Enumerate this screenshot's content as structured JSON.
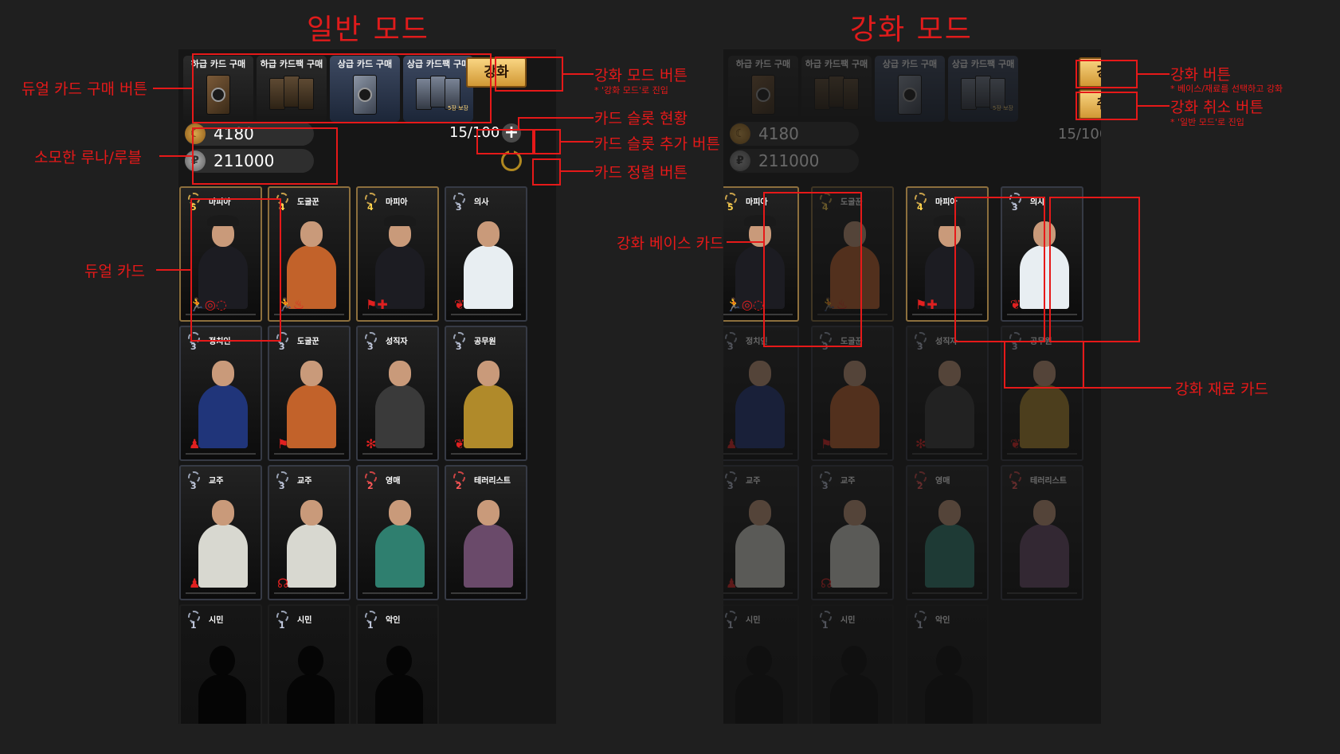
{
  "titles": {
    "normal_mode": "일반 모드",
    "enhance_mode": "강화 모드"
  },
  "store": [
    {
      "label": "하급 카드 구매",
      "tier": "low"
    },
    {
      "label": "하급 카드팩 구매",
      "tier": "low"
    },
    {
      "label": "상급 카드 구매",
      "tier": "high"
    },
    {
      "label": "상급 카드팩 구매",
      "tier": "high",
      "pack_tag": "5장 보장"
    }
  ],
  "buttons": {
    "enhance": "강화",
    "cancel": "취소",
    "plus": "+"
  },
  "currency": {
    "luna": "4180",
    "ruble": "211000",
    "luna_glyph": "☾",
    "ruble_glyph": "₽"
  },
  "slots": "15/100",
  "cards": [
    {
      "name": "마피아",
      "level": "5",
      "badge": "gold",
      "frame": "gold",
      "body": "#1c1c22",
      "icons": "🏃◎◌"
    },
    {
      "name": "도굴꾼",
      "level": "4",
      "badge": "gold",
      "frame": "gold",
      "body": "#c2622a",
      "icons": "🏃♨"
    },
    {
      "name": "마피아",
      "level": "4",
      "badge": "gold",
      "frame": "gold",
      "body": "#1c1c22",
      "icons": "⚑✚"
    },
    {
      "name": "의사",
      "level": "3",
      "badge": "silver",
      "frame": "steel",
      "body": "#e8eef2",
      "icons": "❦"
    },
    {
      "name": "정치인",
      "level": "3",
      "badge": "silver",
      "frame": "steel",
      "body": "#20357a",
      "icons": "♟"
    },
    {
      "name": "도굴꾼",
      "level": "3",
      "badge": "silver",
      "frame": "steel",
      "body": "#c2622a",
      "icons": "⚑"
    },
    {
      "name": "성직자",
      "level": "3",
      "badge": "silver",
      "frame": "steel",
      "body": "#3a3a3a",
      "icons": "✻"
    },
    {
      "name": "공무원",
      "level": "3",
      "badge": "silver",
      "frame": "steel",
      "body": "#b08a2a",
      "icons": "❦"
    },
    {
      "name": "교주",
      "level": "3",
      "badge": "silver",
      "frame": "steel",
      "body": "#d8d8d0",
      "icons": "♟"
    },
    {
      "name": "교주",
      "level": "3",
      "badge": "silver",
      "frame": "steel",
      "body": "#d8d8d0",
      "icons": "☊"
    },
    {
      "name": "영매",
      "level": "2",
      "badge": "red",
      "frame": "steel",
      "body": "#2f7f6f",
      "icons": ""
    },
    {
      "name": "테러리스트",
      "level": "2",
      "badge": "red",
      "frame": "steel",
      "body": "#6a4a6a",
      "icons": ""
    },
    {
      "name": "시민",
      "level": "1",
      "badge": "silver",
      "frame": "blank",
      "body": "",
      "icons": ""
    },
    {
      "name": "시민",
      "level": "1",
      "badge": "silver",
      "frame": "blank",
      "body": "",
      "icons": ""
    },
    {
      "name": "악인",
      "level": "1",
      "badge": "silver",
      "frame": "blank",
      "body": "",
      "icons": ""
    }
  ],
  "annotations": {
    "dual_card_buy": "듀얼 카드 구매 버튼",
    "enhance_mode_button": "강화 모드 버튼",
    "enhance_mode_button_note": "* '강화 모드'로 진입",
    "slot_status": "카드 슬롯 현황",
    "slot_add": "카드 슬롯 추가 버튼",
    "sort": "카드 정렬 버튼",
    "currency": "소모한 루나/루블",
    "dual_card": "듀얼 카드",
    "enhance_button": "강화 버튼",
    "enhance_button_note": "* 베이스/재료를 선택하고 강화",
    "cancel_button": "강화 취소 버튼",
    "cancel_button_note": "* '일반 모드'로 진입",
    "base_card": "강화 베이스 카드",
    "material_card": "강화 재료 카드"
  },
  "colors": {
    "annotation": "#e61919",
    "gold_button": "#e6b24f",
    "panel_bg": "#161616"
  }
}
